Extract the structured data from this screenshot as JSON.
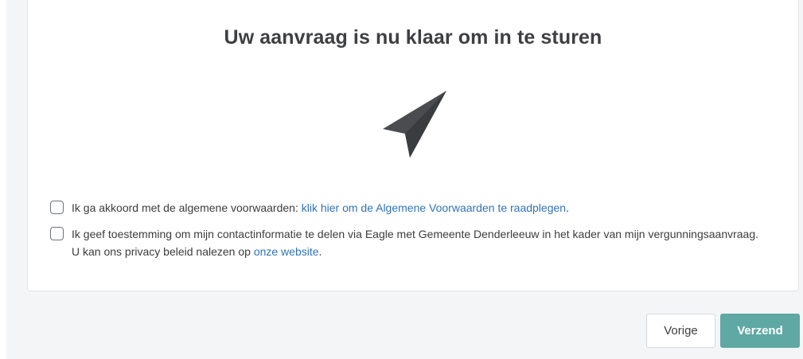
{
  "card": {
    "title": "Uw aanvraag is nu klaar om in te sturen",
    "illustration_icon": "paper-plane-icon"
  },
  "consents": [
    {
      "checked": false,
      "text": "Ik ga akkoord met de algemene voorwaarden: ",
      "link_text": "klik hier om de Algemene Voorwaarden te raadplegen",
      "suffix": "."
    },
    {
      "checked": false,
      "text": "Ik geef toestemming om mijn contactinformatie te delen via Eagle met Gemeente Denderleeuw in het kader van mijn vergunningsaanvraag. U kan ons privacy beleid nalezen op ",
      "link_text": "onze website",
      "suffix": "."
    }
  ],
  "actions": {
    "previous_label": "Vorige",
    "send_label": "Verzend"
  },
  "colors": {
    "accent": "#5fa8a4",
    "link": "#2f73b8",
    "icon": "#4a4c50"
  }
}
